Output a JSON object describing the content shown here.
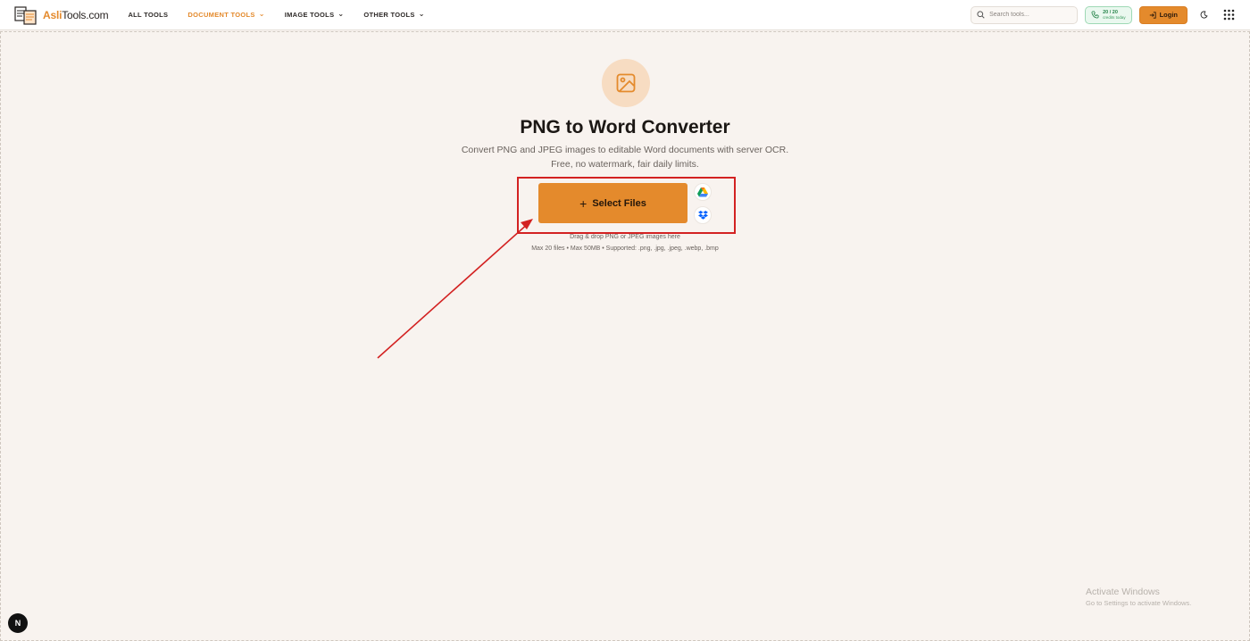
{
  "header": {
    "logo_text": "AsliTools.com",
    "logo_prefix": "Asli",
    "logo_suffix": "Tools.com",
    "nav": [
      {
        "label": "ALL TOOLS",
        "has_dropdown": false,
        "active": false
      },
      {
        "label": "DOCUMENT TOOLS",
        "has_dropdown": true,
        "active": true
      },
      {
        "label": "IMAGE TOOLS",
        "has_dropdown": true,
        "active": false
      },
      {
        "label": "OTHER TOOLS",
        "has_dropdown": true,
        "active": false
      }
    ],
    "search_placeholder": "Search tools...",
    "credits_count": "20 / 20",
    "credits_label": "credits today",
    "login_label": "Login"
  },
  "main": {
    "title": "PNG to Word Converter",
    "subtitle_line1": "Convert PNG and JPEG images to editable Word documents with server OCR.",
    "subtitle_line2": "Free, no watermark, fair daily limits.",
    "select_files_label": "Select Files",
    "hint_drag": "Drag & drop PNG or JPEG images here",
    "hint_limits": "Max 20 files • Max 50MB • Supported: .png, .jpg, .jpeg, .webp, .bmp"
  },
  "watermark": {
    "title": "Activate Windows",
    "subtitle": "Go to Settings to activate Windows."
  },
  "badge_letter": "N",
  "colors": {
    "accent": "#e48a2c",
    "background": "#f8f3ef",
    "annotation": "#d32222",
    "credits_green": "#26844a"
  },
  "icons": {
    "hero": "image-icon",
    "search": "search-icon",
    "credits": "phone-icon",
    "login": "login-icon",
    "theme": "moon-icon",
    "apps": "grid-icon",
    "cloud1": "google-drive-icon",
    "cloud2": "dropbox-icon"
  }
}
